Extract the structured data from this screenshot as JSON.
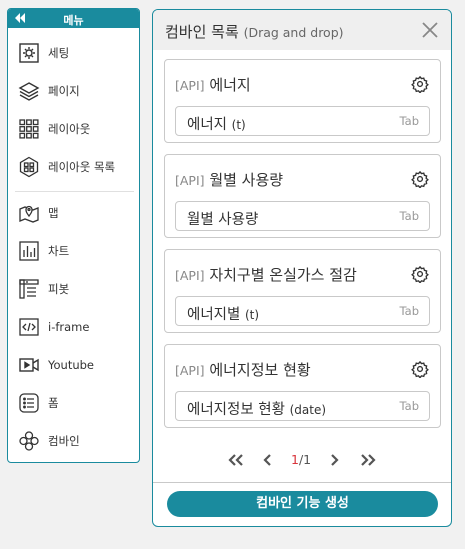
{
  "sidebar": {
    "title": "메뉴",
    "items": [
      {
        "label": "세팅",
        "icon": "gear-icon"
      },
      {
        "label": "페이지",
        "icon": "layers-icon"
      },
      {
        "label": "레이아웃",
        "icon": "grid-icon"
      },
      {
        "label": "레이아웃 목록",
        "icon": "layout-list-icon"
      },
      {
        "label": "맵",
        "icon": "map-icon"
      },
      {
        "label": "차트",
        "icon": "bar-chart-icon"
      },
      {
        "label": "피봇",
        "icon": "pivot-icon"
      },
      {
        "label": "i-frame",
        "icon": "code-icon"
      },
      {
        "label": "Youtube",
        "icon": "video-icon"
      },
      {
        "label": "폼",
        "icon": "form-icon"
      },
      {
        "label": "컴바인",
        "icon": "combine-icon"
      }
    ]
  },
  "panel": {
    "title": "컴바인 목록",
    "subtitle": "(Drag and drop)",
    "cards": [
      {
        "tag": "[API]",
        "title": "에너지",
        "field_value": "에너지",
        "field_unit": "(t)",
        "hint": "Tab"
      },
      {
        "tag": "[API]",
        "title": "월별 사용량",
        "field_value": "월별 사용량",
        "field_unit": "",
        "hint": "Tab"
      },
      {
        "tag": "[API]",
        "title": "자치구별 온실가스 절감",
        "field_value": "에너지별",
        "field_unit": "(t)",
        "hint": "Tab"
      },
      {
        "tag": "[API]",
        "title": "에너지정보 현황",
        "field_value": "에너지정보 현황",
        "field_unit": "(date)",
        "hint": "Tab"
      }
    ],
    "pagination": {
      "current": "1",
      "total": "/1"
    },
    "create_button": "컴바인 기능 생성"
  },
  "colors": {
    "accent": "#1a8b9e",
    "current_page": "#d9343b"
  }
}
